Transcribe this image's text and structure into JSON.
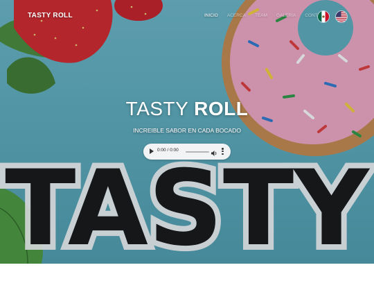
{
  "header": {
    "brand": "TASTY ROLL",
    "nav": [
      {
        "label": "INICIO"
      },
      {
        "label": "ACERCA"
      },
      {
        "label": "TEAM"
      },
      {
        "label": "GALERIA"
      },
      {
        "label": "CONTACTO"
      }
    ],
    "languages": [
      {
        "icon": "mexico-flag-icon"
      },
      {
        "icon": "usa-flag-icon"
      }
    ]
  },
  "hero": {
    "title_light": "TASTY",
    "title_bold": "ROLL",
    "subtitle": "INCREIBLE SABOR EN CADA BOCADO",
    "background_word": "TASTY",
    "colors": {
      "background": "#5eaebf",
      "donut_icing": "#f3a9c6",
      "strawberry": "#d4262b",
      "leaf": "#4a8b3a"
    }
  },
  "audio_player": {
    "time": "0:00 / 0:00",
    "progress": 0
  }
}
